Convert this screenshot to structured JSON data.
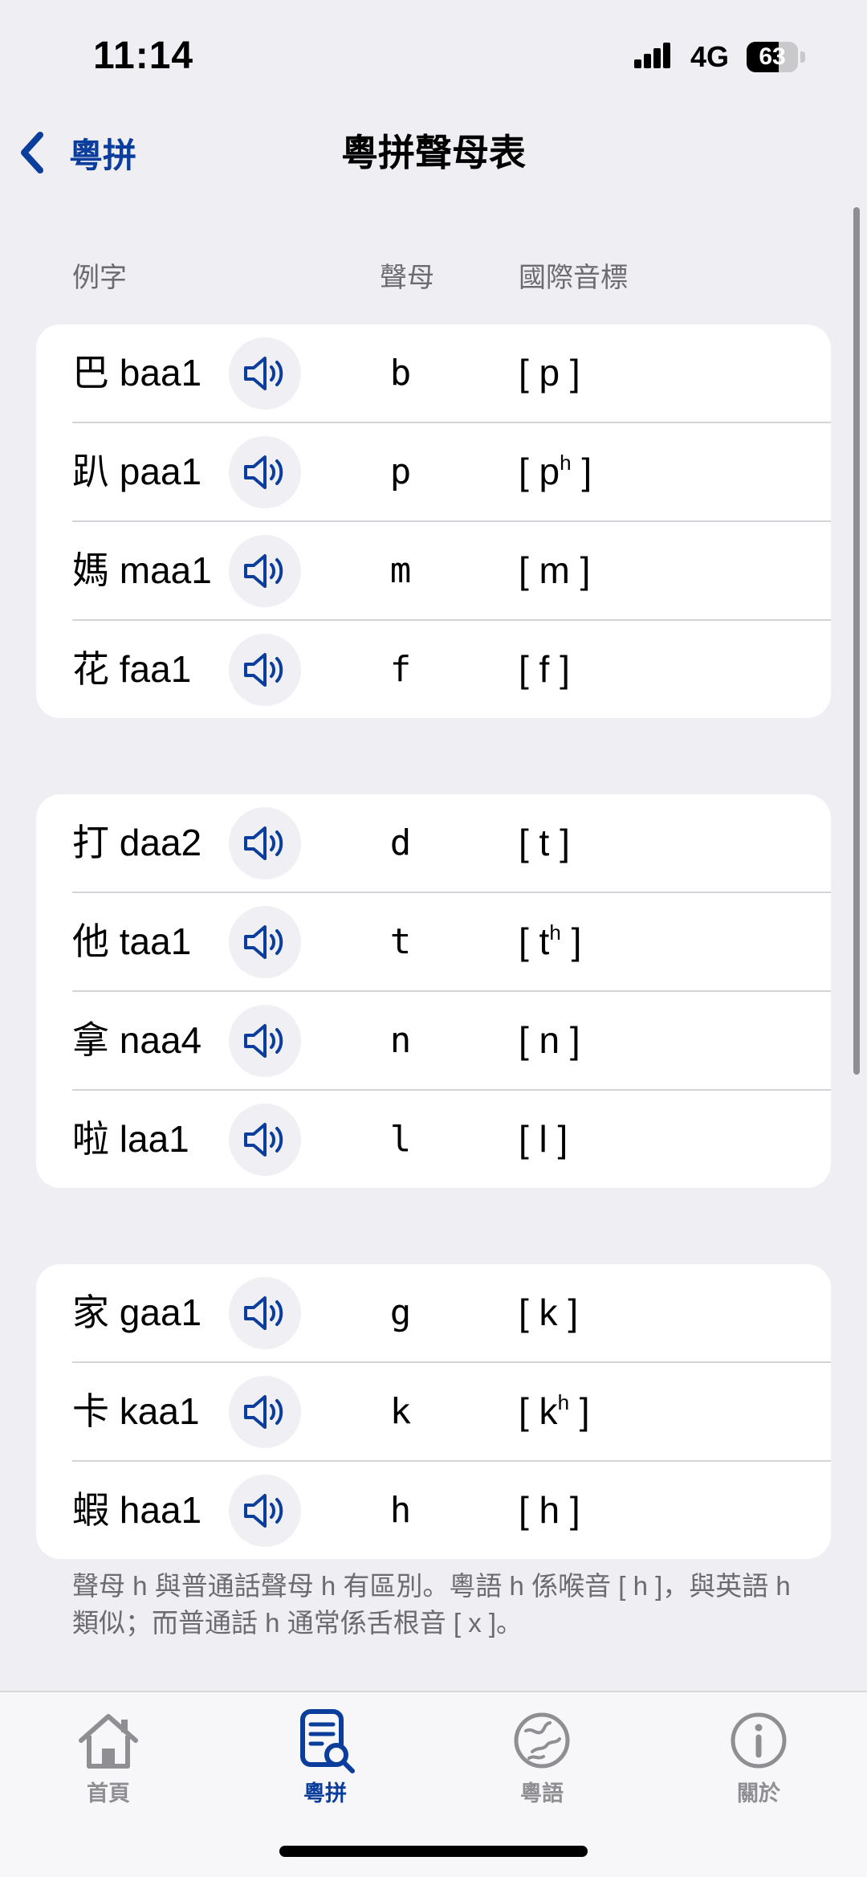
{
  "status": {
    "time": "11:14",
    "network": "4G",
    "battery": "63",
    "battery_level": 0.63
  },
  "nav": {
    "back_label": "粵拼",
    "title": "粵拼聲母表"
  },
  "columns": {
    "example": "例字",
    "initial": "聲母",
    "ipa": "國際音標"
  },
  "groups": [
    {
      "rows": [
        {
          "example": "巴 baa1",
          "initial": "b",
          "ipa": "[ p ]",
          "asp": ""
        },
        {
          "example": "趴 paa1",
          "initial": "p",
          "ipa": "[ p",
          "asp": "h"
        },
        {
          "example": "媽 maa1",
          "initial": "m",
          "ipa": "[ m ]",
          "asp": ""
        },
        {
          "example": "花 faa1",
          "initial": "f",
          "ipa": "[ f ]",
          "asp": ""
        }
      ]
    },
    {
      "rows": [
        {
          "example": "打 daa2",
          "initial": "d",
          "ipa": "[ t ]",
          "asp": ""
        },
        {
          "example": "他 taa1",
          "initial": "t",
          "ipa": "[ t",
          "asp": "h"
        },
        {
          "example": "拿 naa4",
          "initial": "n",
          "ipa": "[ n ]",
          "asp": ""
        },
        {
          "example": "啦 laa1",
          "initial": "l",
          "ipa": "[ l ]",
          "asp": ""
        }
      ]
    },
    {
      "rows": [
        {
          "example": "家 gaa1",
          "initial": "g",
          "ipa": "[ k ]",
          "asp": ""
        },
        {
          "example": "卡 kaa1",
          "initial": "k",
          "ipa": "[ k",
          "asp": "h"
        },
        {
          "example": "蝦 haa1",
          "initial": "h",
          "ipa": "[ h ]",
          "asp": ""
        }
      ]
    }
  ],
  "note": "聲母 h 與普通話聲母 h 有區別。粵語 h 係喉音 [ h ]，與英語 h 類似；而普通話 h 通常係舌根音 [ x ]。",
  "tabs": [
    {
      "label": "首頁",
      "icon": "house-icon",
      "active": false
    },
    {
      "label": "粵拼",
      "icon": "document-search-icon",
      "active": true
    },
    {
      "label": "粵語",
      "icon": "globe-icon",
      "active": false
    },
    {
      "label": "關於",
      "icon": "info-icon",
      "active": false
    }
  ],
  "colors": {
    "accent": "#0a3d9c",
    "background": "#eeeef3",
    "secondary_text": "#6b6b70"
  }
}
